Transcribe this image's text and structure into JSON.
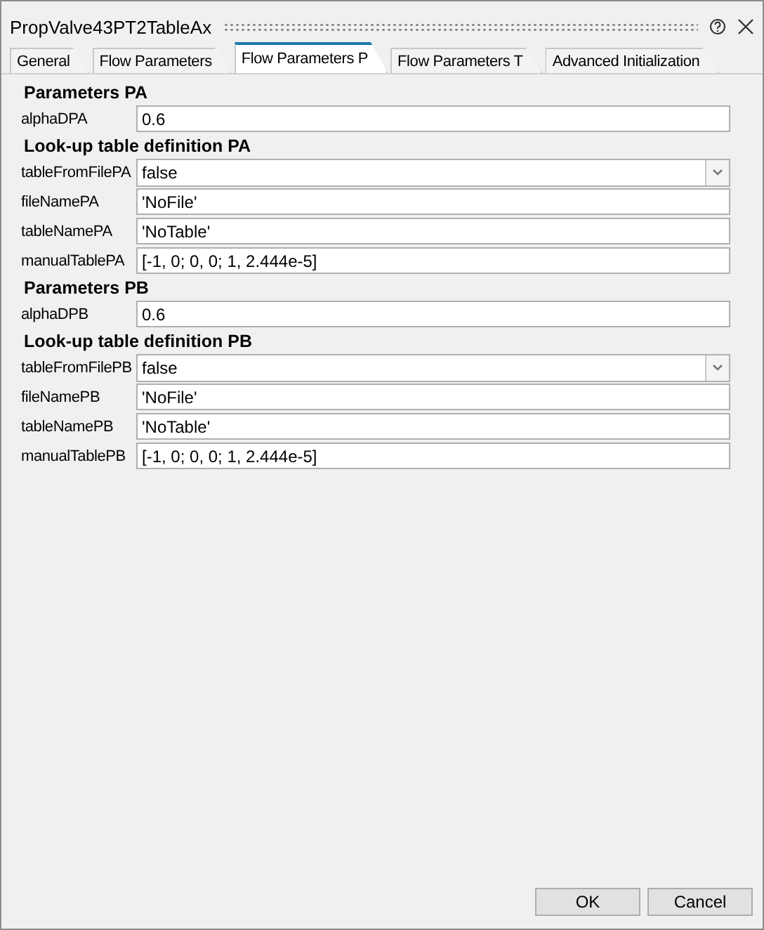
{
  "window": {
    "title": "PropValve43PT2TableAx"
  },
  "tabs": [
    {
      "label": "General",
      "selected": false
    },
    {
      "label": "Flow Parameters",
      "selected": false
    },
    {
      "label": "Flow Parameters P",
      "selected": true
    },
    {
      "label": "Flow Parameters T",
      "selected": false
    },
    {
      "label": "Advanced Initialization",
      "selected": false
    }
  ],
  "rows": [
    {
      "kind": "heading",
      "text": "Parameters PA"
    },
    {
      "kind": "text",
      "label": "alphaDPA",
      "value": "0.6"
    },
    {
      "kind": "heading",
      "text": "Look-up table definition PA"
    },
    {
      "kind": "dropdown",
      "label": "tableFromFilePA",
      "value": "false"
    },
    {
      "kind": "text",
      "label": "fileNamePA",
      "value": "'NoFile'"
    },
    {
      "kind": "text",
      "label": "tableNamePA",
      "value": "'NoTable'"
    },
    {
      "kind": "text",
      "label": "manualTablePA",
      "value": "[-1, 0; 0, 0; 1, 2.444e-5]"
    },
    {
      "kind": "heading",
      "text": "Parameters PB"
    },
    {
      "kind": "text",
      "label": "alphaDPB",
      "value": "0.6"
    },
    {
      "kind": "heading",
      "text": "Look-up table definition PB"
    },
    {
      "kind": "dropdown",
      "label": "tableFromFilePB",
      "value": "false"
    },
    {
      "kind": "text",
      "label": "fileNamePB",
      "value": "'NoFile'"
    },
    {
      "kind": "text",
      "label": "tableNamePB",
      "value": "'NoTable'"
    },
    {
      "kind": "text",
      "label": "manualTablePB",
      "value": "[-1, 0; 0, 0; 1, 2.444e-5]"
    }
  ],
  "buttons": [
    "OK",
    "Cancel"
  ]
}
